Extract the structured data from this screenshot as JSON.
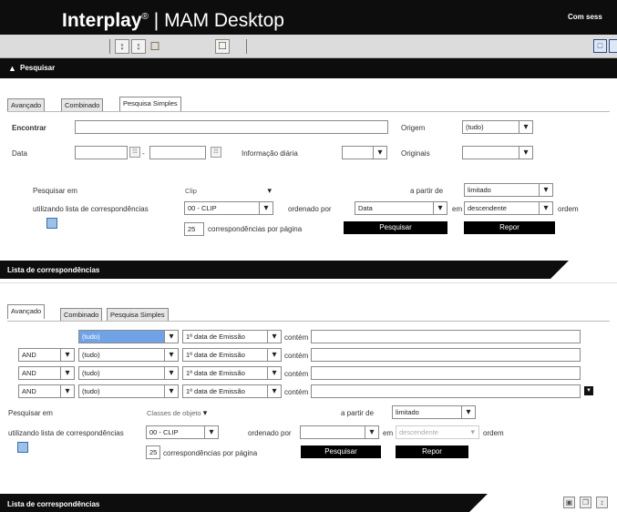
{
  "header": {
    "brand": "Interplay",
    "reg": "®",
    "separator": "|",
    "product": "MAM Desktop",
    "session_text": "Com sess"
  },
  "search_section": {
    "title": "Pesquisar",
    "collapse_icon": "caret-up-icon",
    "tabs": [
      "Avançado",
      "Combinado",
      "Pesquisa Simples"
    ],
    "active_tab": 2,
    "find_label": "Encontrar",
    "find_value": "",
    "origin_label": "Origem",
    "origin_value": "(tudo)",
    "date_label": "Data",
    "date_separator": "-",
    "daily_info_label": "Informação diária",
    "daily_info_value": "",
    "originals_label": "Originais",
    "originals_value": "",
    "search_in_label": "Pesquisar em",
    "search_in_value": "Clip",
    "from_label": "a partir de",
    "from_value": "limitado",
    "match_list_label": "utilizando lista de correspondências",
    "match_list_value": "00 - CLIP",
    "ordered_by_label": "ordenado por",
    "ordered_by_value": "Data",
    "in_label": "em",
    "order_direction_value": "descendente",
    "order_label": "ordem",
    "per_page_value": "25",
    "per_page_label": "correspondências por página",
    "search_button": "Pesquisar",
    "reset_button": "Repor"
  },
  "results_bar_1": {
    "title": "Lista de correspondências"
  },
  "advanced_section": {
    "tabs": [
      "Avançado",
      "Combinado",
      "Pesquisa Simples"
    ],
    "active_tab": 0,
    "rows": [
      {
        "operator": "",
        "field": "(tudo)",
        "attribute": "1ª data de Emissão",
        "condition": "contém",
        "value": ""
      },
      {
        "operator": "AND",
        "field": "(tudo)",
        "attribute": "1ª data de Emissão",
        "condition": "contém",
        "value": ""
      },
      {
        "operator": "AND",
        "field": "(tudo)",
        "attribute": "1ª data de Emissão",
        "condition": "contém",
        "value": ""
      },
      {
        "operator": "AND",
        "field": "(tudo)",
        "attribute": "1ª data de Emissão",
        "condition": "contém",
        "value": ""
      }
    ],
    "search_in_label": "Pesquisar em",
    "search_in_value": "Classes de objeto",
    "from_label": "a partir de",
    "from_value": "limitado",
    "match_list_label": "utilizando lista de correspondências",
    "match_list_value": "00 - CLIP",
    "ordered_by_label": "ordenado por",
    "ordered_by_value": "",
    "in_label": "em",
    "order_direction_value": "descendente",
    "order_label": "ordem",
    "per_page_value": "25",
    "per_page_label": "correspondências por página",
    "search_button": "Pesquisar",
    "reset_button": "Repor"
  },
  "results_bar_2": {
    "title": "Lista de correspondências"
  },
  "colors": {
    "bar": "#0d0d0d",
    "toolbar": "#dcdcdc",
    "highlight": "#6fa3e6"
  }
}
